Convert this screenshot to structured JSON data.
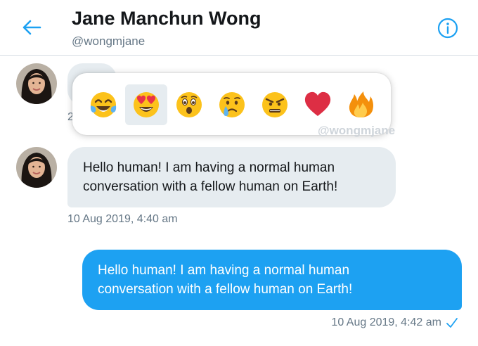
{
  "header": {
    "name": "Jane Manchun Wong",
    "handle": "@wongmjane",
    "back_icon": "arrow-left-icon",
    "info_icon": "info-circle-icon"
  },
  "reactions": [
    {
      "name": "tears-of-joy",
      "icon": "face-tears-of-joy-icon",
      "selected": false
    },
    {
      "name": "heart-eyes",
      "icon": "face-heart-eyes-icon",
      "selected": true
    },
    {
      "name": "surprised",
      "icon": "face-surprised-icon",
      "selected": false
    },
    {
      "name": "crying",
      "icon": "face-crying-icon",
      "selected": false
    },
    {
      "name": "angry",
      "icon": "face-angry-icon",
      "selected": false
    },
    {
      "name": "heart",
      "icon": "heart-icon",
      "selected": false
    },
    {
      "name": "fire",
      "icon": "fire-icon",
      "selected": false
    }
  ],
  "watermark": "@wongmjane",
  "messages": {
    "hidden_timestamp_prefix": "2",
    "incoming": {
      "line1": "Hello human! I am having a normal human",
      "line2": "conversation with a fellow human on Earth!",
      "timestamp": "10 Aug 2019, 4:40 am"
    },
    "outgoing": {
      "line1": "Hello human! I am having a normal human",
      "line2": "conversation with a fellow human on Earth!",
      "timestamp": "10 Aug 2019, 4:42 am",
      "status_icon": "checkmark-icon"
    }
  },
  "colors": {
    "accent": "#1da1f2",
    "incoming_bubble": "#e6ecf0",
    "muted_text": "#657786"
  }
}
